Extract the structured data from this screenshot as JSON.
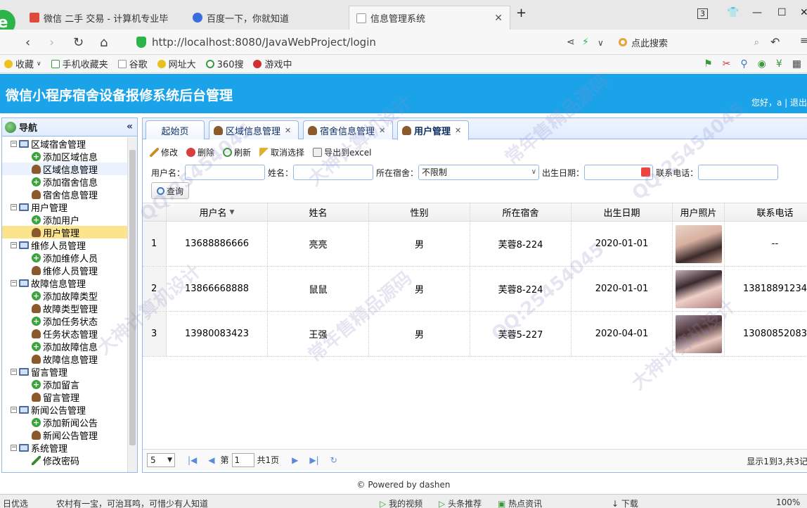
{
  "browser": {
    "tabs": [
      {
        "label": "微信 二手 交易 - 计算机专业毕"
      },
      {
        "label": "百度一下，你就知道"
      },
      {
        "label": "信息管理系统"
      }
    ],
    "tab_count_badge": "3",
    "url": "http://localhost:8080/JavaWebProject/login",
    "search_label": "点此搜索",
    "bookmarks": [
      "收藏",
      "手机收藏夹",
      "谷歌",
      "网址大",
      "360搜",
      "游戏中"
    ]
  },
  "app": {
    "title": "微信小程序宿舍设备报修系统后台管理",
    "user_text": "您好，a | 退出"
  },
  "sidebar": {
    "title": "导航",
    "collapse_icon": "«",
    "groups": [
      {
        "label": "区域宿舍管理",
        "items": [
          "添加区域信息",
          "区域信息管理",
          "添加宿舍信息",
          "宿舍信息管理"
        ]
      },
      {
        "label": "用户管理",
        "items": [
          "添加用户",
          "用户管理"
        ]
      },
      {
        "label": "维修人员管理",
        "items": [
          "添加维修人员",
          "维修人员管理"
        ]
      },
      {
        "label": "故障信息管理",
        "items": [
          "添加故障类型",
          "故障类型管理",
          "添加任务状态",
          "任务状态管理",
          "添加故障信息",
          "故障信息管理"
        ]
      },
      {
        "label": "留言管理",
        "items": [
          "添加留言",
          "留言管理"
        ]
      },
      {
        "label": "新闻公告管理",
        "items": [
          "添加新闻公告",
          "新闻公告管理"
        ]
      },
      {
        "label": "系统管理",
        "items": [
          "修改密码"
        ]
      }
    ]
  },
  "tabs": [
    "起始页",
    "区域信息管理",
    "宿舍信息管理",
    "用户管理"
  ],
  "toolbar": {
    "edit": "修改",
    "delete": "删除",
    "refresh": "刷新",
    "unselect": "取消选择",
    "export": "导出到excel"
  },
  "filters": {
    "username_label": "用户名：",
    "name_label": "姓名：",
    "dorm_label": "所在宿舍：",
    "dorm_value": "不限制",
    "birth_label": "出生日期：",
    "phone_label": "联系电话：",
    "query_button": "查询"
  },
  "grid": {
    "columns": [
      "用户名",
      "姓名",
      "性别",
      "所在宿舍",
      "出生日期",
      "用户照片",
      "联系电话"
    ],
    "rows": [
      {
        "num": "1",
        "username": "13688886666",
        "name": "亮亮",
        "gender": "男",
        "dorm": "芙蓉8-224",
        "birth": "2020-01-01",
        "phone": "--"
      },
      {
        "num": "2",
        "username": "13866668888",
        "name": "鼠鼠",
        "gender": "男",
        "dorm": "芙蓉8-224",
        "birth": "2020-01-01",
        "phone": "13818891234"
      },
      {
        "num": "3",
        "username": "13980083423",
        "name": "王强",
        "gender": "男",
        "dorm": "芙蓉5-227",
        "birth": "2020-04-01",
        "phone": "13080852083"
      }
    ]
  },
  "pager": {
    "page_size": "5",
    "page_prefix": "第",
    "page_value": "1",
    "page_suffix": "共1页",
    "info": "显示1到3,共3记"
  },
  "footer": "© Powered by dashen",
  "statusbar": {
    "left1": "日优选",
    "left2": "农村有一宝，可治耳鸣，可惜少有人知道",
    "video": "我的视频",
    "headline": "头条推荐",
    "hot": "热点资讯",
    "download": "下载",
    "zoom": "100%"
  },
  "watermarks": [
    "QQ:25454045",
    "大神计算机设计",
    "常年售精品源码",
    "QQ:25454045",
    "大神计算机设计",
    "常年售精品源码",
    "QQ:25454045",
    "大神计算机设计"
  ],
  "colors": {
    "header_bg": "#1aa3e8",
    "panel_border": "#95b8e7",
    "highlight": "#fbe48c"
  }
}
